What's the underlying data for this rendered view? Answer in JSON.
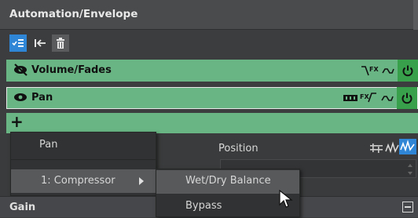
{
  "panel": {
    "title": "Automation/Envelope"
  },
  "tracks": [
    {
      "name": "Volume/Fades",
      "fx": "FX",
      "power": "on"
    },
    {
      "name": "Pan",
      "fx": "FX",
      "power": "on"
    }
  ],
  "add_label": "+",
  "properties": {
    "position_label": "Position"
  },
  "bottom": {
    "title": "Gain"
  },
  "menu": {
    "items": [
      "Pan",
      "1: Compressor"
    ],
    "submenu": [
      "Wet/Dry Balance",
      "Bypass"
    ]
  },
  "colors": {
    "track_bg": "#69b584",
    "power_bg": "#38a04b",
    "accent": "#2f86d6"
  }
}
